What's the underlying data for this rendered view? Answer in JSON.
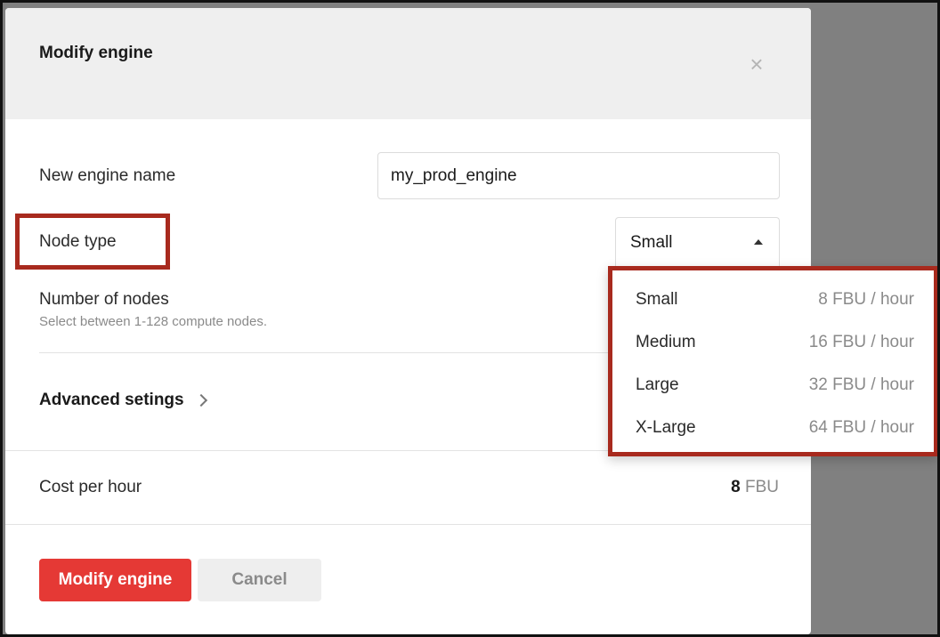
{
  "modal": {
    "title": "Modify engine",
    "close_icon": "×"
  },
  "form": {
    "engine_name_label": "New engine name",
    "engine_name_value": "my_prod_engine",
    "node_type_label": "Node type",
    "node_type_value": "Small",
    "nodes_label": "Number of nodes",
    "nodes_hint": "Select between 1-128 compute nodes.",
    "advanced_label": "Advanced setings",
    "cost_label": "Cost per hour",
    "cost_value": "8",
    "cost_unit": "FBU"
  },
  "dropdown": {
    "options": [
      {
        "name": "Small",
        "cost": "8 FBU / hour"
      },
      {
        "name": "Medium",
        "cost": "16 FBU / hour"
      },
      {
        "name": "Large",
        "cost": "32 FBU / hour"
      },
      {
        "name": "X-Large",
        "cost": "64 FBU / hour"
      }
    ]
  },
  "buttons": {
    "primary": "Modify engine",
    "secondary": "Cancel"
  },
  "colors": {
    "primary": "#e53935",
    "highlight": "#a82a1e",
    "backdrop": "#808080"
  }
}
